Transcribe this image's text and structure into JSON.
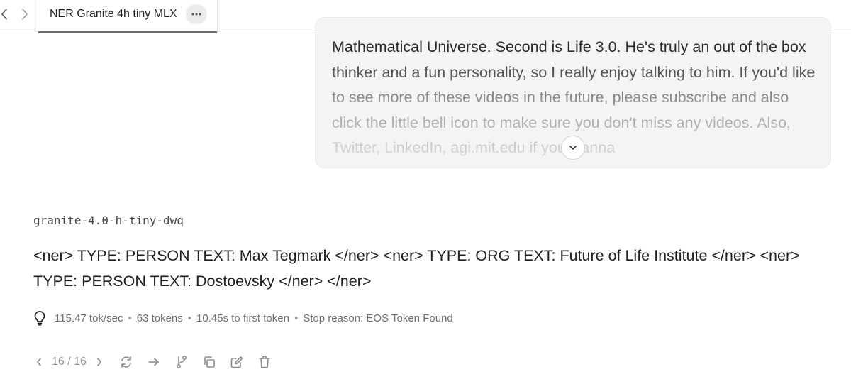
{
  "tab": {
    "title": "NER Granite 4h tiny MLX"
  },
  "bubble": {
    "text": "Mathematical Universe. Second is Life 3.0. He's truly an out of the box thinker and a fun personality, so I really enjoy talking to him. If you'd like to see more of these videos in the future, please subscribe and also click the little bell icon to make sure you don't miss any videos. Also, Twitter, LinkedIn, agi.mit.edu if you wanna"
  },
  "response": {
    "model": "granite-4.0-h-tiny-dwq",
    "text": "<ner> TYPE: PERSON TEXT: Max Tegmark </ner> <ner> TYPE: ORG TEXT: Future of Life Institute </ner> <ner> TYPE: PERSON TEXT: Dostoevsky </ner> </ner>"
  },
  "stats": {
    "speed": "115.47 tok/sec",
    "tokens": "63 tokens",
    "first_token": "10.45s to first token",
    "stop_reason": "Stop reason: EOS Token Found"
  },
  "pager": {
    "label": "16 / 16"
  },
  "icons": [
    "chevron-left-icon",
    "chevron-right-icon",
    "more-icon",
    "chevron-down-icon",
    "lightbulb-icon",
    "regenerate-icon",
    "continue-icon",
    "branch-icon",
    "copy-icon",
    "edit-icon",
    "trash-icon"
  ]
}
